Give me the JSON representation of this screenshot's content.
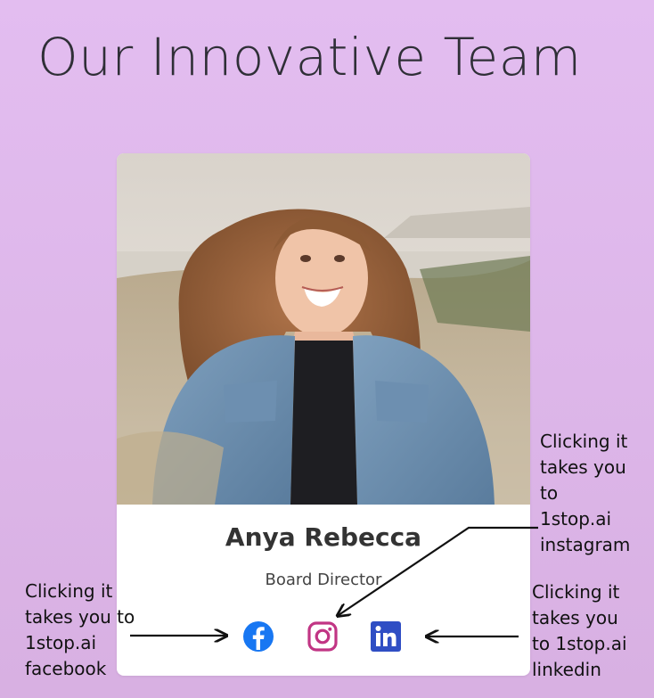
{
  "page": {
    "title": "Our Innovative Team"
  },
  "member": {
    "name": "Anya Rebecca",
    "role": "Board Director",
    "photo": "photo of smiling woman with wavy hair in denim jacket sitting in a grassy field"
  },
  "social": [
    {
      "name": "facebook",
      "icon": "facebook-icon",
      "color": "#1877f2"
    },
    {
      "name": "instagram",
      "icon": "instagram-icon",
      "color": "#c13584"
    },
    {
      "name": "linkedin",
      "icon": "linkedin-icon",
      "color": "#2f4ec4"
    }
  ],
  "annotations": {
    "facebook": "Clicking it\ntakes you to\n1stop.ai\nfacebook",
    "instagram": "Clicking it\ntakes you\nto\n1stop.ai\ninstagram",
    "linkedin": "Clicking it\ntakes you\nto 1stop.ai\nlinkedin"
  },
  "colors": {
    "background": "#e0baed",
    "card": "#ffffff",
    "text": "#333333"
  }
}
